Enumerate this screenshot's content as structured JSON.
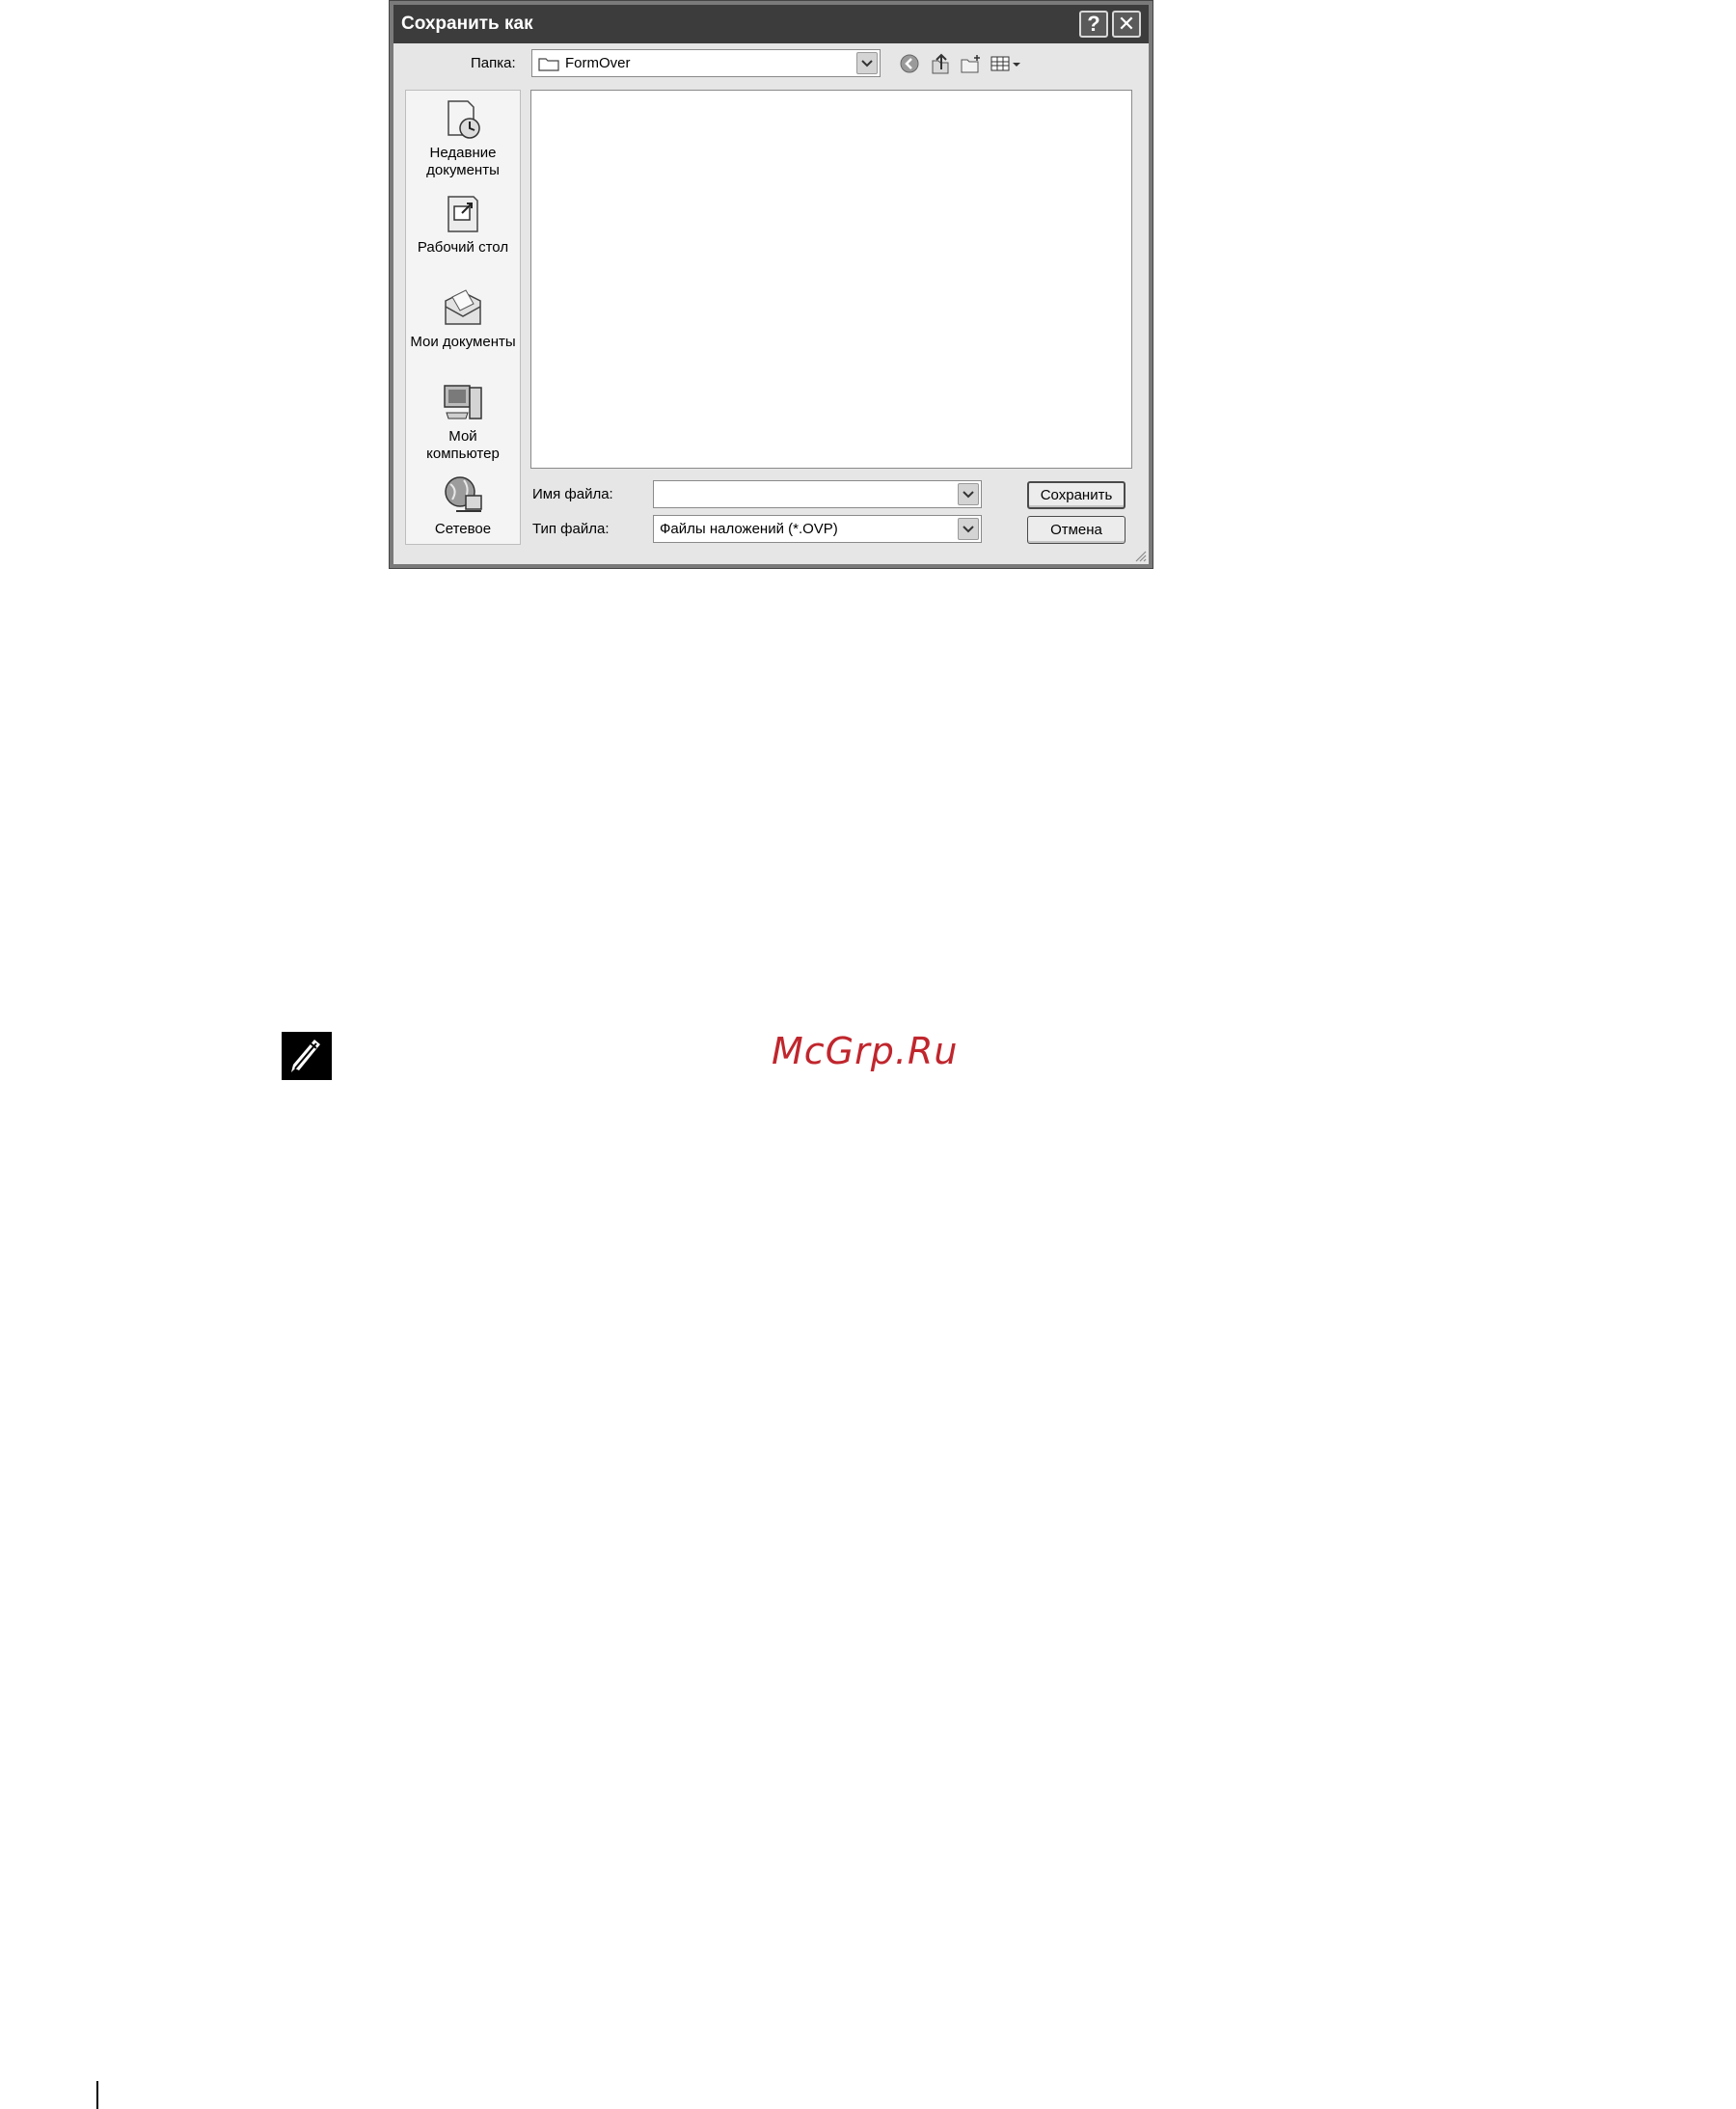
{
  "dialog": {
    "title": "Сохранить как",
    "help_glyph": "?",
    "close_glyph": "✕"
  },
  "folder": {
    "label": "Папка:",
    "value": "FormOver"
  },
  "places": [
    {
      "label_line1": "Недавние",
      "label_line2": "документы",
      "icon": "recent-documents-icon"
    },
    {
      "label_line1": "Рабочий стол",
      "label_line2": "",
      "icon": "desktop-icon"
    },
    {
      "label_line1": "Мои документы",
      "label_line2": "",
      "icon": "my-documents-icon"
    },
    {
      "label_line1": "Мой",
      "label_line2": "компьютер",
      "icon": "my-computer-icon"
    },
    {
      "label_line1": "Сетевое",
      "label_line2": "",
      "icon": "network-icon"
    }
  ],
  "filename": {
    "label": "Имя файла:",
    "value": ""
  },
  "filetype": {
    "label": "Тип файла:",
    "value": "Файлы наложений (*.OVP)"
  },
  "buttons": {
    "save": "Сохранить",
    "cancel": "Отмена"
  },
  "watermark": "McGrp.Ru",
  "colors": {
    "watermark": "#c0262d",
    "titlebar": "#3c3c3c"
  }
}
